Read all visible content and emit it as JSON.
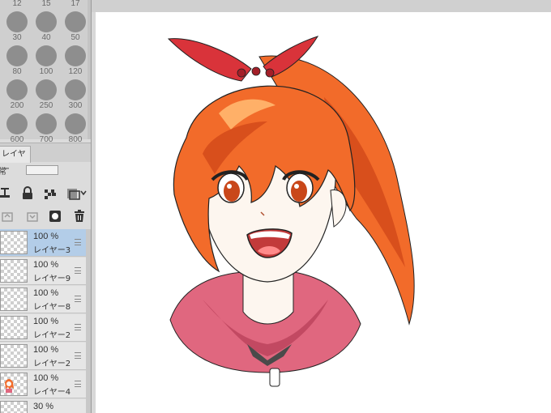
{
  "brush_sizes": [
    {
      "label": "12"
    },
    {
      "label": "15"
    },
    {
      "label": "17"
    },
    {
      "label": "30"
    },
    {
      "label": "40"
    },
    {
      "label": "50"
    },
    {
      "label": "80"
    },
    {
      "label": "100"
    },
    {
      "label": "120"
    },
    {
      "label": "200"
    },
    {
      "label": "250"
    },
    {
      "label": "300"
    },
    {
      "label": "600"
    },
    {
      "label": "700"
    },
    {
      "label": "800"
    }
  ],
  "layer_panel": {
    "tab_label": "レイヤー",
    "blend_mode": "通常"
  },
  "layers": [
    {
      "opacity": "100 %",
      "name": "レイヤー3",
      "selected": true
    },
    {
      "opacity": "100 %",
      "name": "レイヤー9",
      "selected": false
    },
    {
      "opacity": "100 %",
      "name": "レイヤー8",
      "selected": false
    },
    {
      "opacity": "100 %",
      "name": "レイヤー2",
      "selected": false
    },
    {
      "opacity": "100 %",
      "name": "レイヤー2",
      "selected": false
    },
    {
      "opacity": "100 %",
      "name": "レイヤー4",
      "selected": false
    },
    {
      "opacity": "30 %",
      "name": "",
      "selected": false
    }
  ],
  "colors": {
    "hair": "#f26b2a",
    "hair_shade": "#d84f1c",
    "ribbon": "#d9333a",
    "hoodie": "#e0677f",
    "hoodie_shade": "#c24962",
    "skin": "#fdf6ef",
    "selected_layer": "#b3cde8"
  }
}
